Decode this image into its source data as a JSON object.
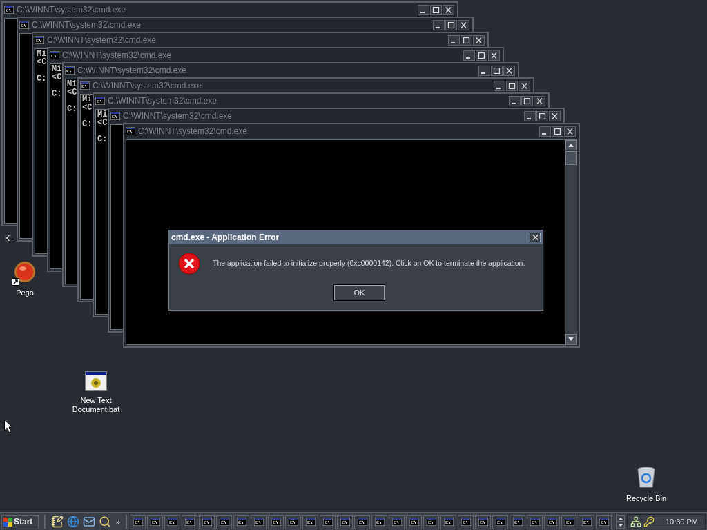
{
  "partial_icon_label": "K-",
  "desktop_icons": [
    {
      "kind": "ball",
      "label": "Pego",
      "shortcut": true
    },
    {
      "kind": "batch",
      "label": "New Text Document.bat",
      "shortcut": false
    },
    {
      "kind": "bin",
      "label": "Recycle Bin",
      "shortcut": false
    }
  ],
  "windows": [
    {
      "title": "C:\\WINNT\\system32\\cmd.exe"
    },
    {
      "title": "C:\\WINNT\\system32\\cmd.exe"
    },
    {
      "title": "C:\\WINNT\\system32\\cmd.exe",
      "console": {
        "banner": [
          "Mi",
          "<C"
        ],
        "prompt": "C:"
      }
    },
    {
      "title": "C:\\WINNT\\system32\\cmd.exe",
      "console": {
        "banner": [
          "Mi",
          "<C"
        ],
        "prompt": "C:"
      }
    },
    {
      "title": "C:\\WINNT\\system32\\cmd.exe",
      "console": {
        "banner": [
          "Mi",
          "<C"
        ],
        "prompt": "C:"
      }
    },
    {
      "title": "C:\\WINNT\\system32\\cmd.exe",
      "console": {
        "banner": [
          "Mi",
          "<C"
        ],
        "prompt": "C:"
      }
    },
    {
      "title": "C:\\WINNT\\system32\\cmd.exe",
      "console": {
        "banner": [
          "Mi",
          "<C"
        ],
        "prompt": "C:"
      }
    },
    {
      "title": "C:\\WINNT\\system32\\cmd.exe"
    },
    {
      "title": "C:\\WINNT\\system32\\cmd.exe"
    }
  ],
  "dialog": {
    "title": "cmd.exe - Application Error",
    "message": "The application failed to initialize properly (0xc0000142). Click on OK to terminate the application.",
    "buttons": [
      "OK"
    ]
  },
  "taskbar": {
    "start": "Start",
    "quick_launch": [
      {
        "kind": "notepad"
      },
      {
        "kind": "browser"
      },
      {
        "kind": "mail"
      },
      {
        "kind": "search"
      }
    ],
    "more": "»",
    "tasks": [
      {
        "selected": false
      },
      {
        "selected": false
      },
      {
        "selected": false
      },
      {
        "selected": false
      },
      {
        "selected": false
      },
      {
        "selected": false
      },
      {
        "selected": false
      },
      {
        "selected": false
      },
      {
        "selected": false
      },
      {
        "selected": false
      },
      {
        "selected": false
      },
      {
        "selected": false
      },
      {
        "selected": false
      },
      {
        "selected": false
      },
      {
        "selected": false
      },
      {
        "selected": false
      },
      {
        "selected": false
      },
      {
        "selected": false
      },
      {
        "selected": false
      },
      {
        "selected": false
      },
      {
        "selected": false
      },
      {
        "selected": false
      },
      {
        "selected": false
      },
      {
        "selected": false
      },
      {
        "selected": false
      },
      {
        "selected": false
      },
      {
        "selected": false
      },
      {
        "selected": false
      }
    ],
    "clock": "10:30 PM"
  }
}
